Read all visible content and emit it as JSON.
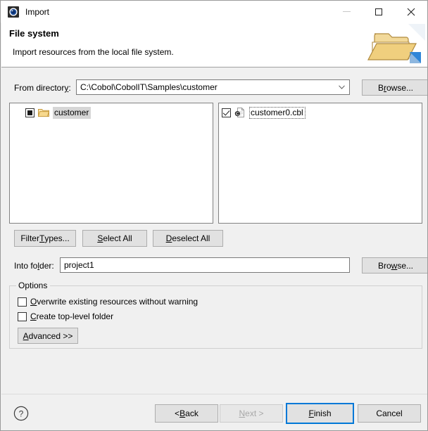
{
  "window": {
    "title": "Import",
    "icon": "eclipse-import-icon",
    "controls": {
      "minimize": "minimize-icon",
      "maximize": "maximize-icon",
      "close": "close-icon"
    }
  },
  "header": {
    "title": "File system",
    "description": "Import resources from the local file system.",
    "graphic": "open-folder-import-icon"
  },
  "from_directory": {
    "label": "From directory:",
    "value": "C:\\Cobol\\CobolIT\\Samples\\customer",
    "browse_label": "Browse..."
  },
  "source_tree": {
    "items": [
      {
        "label": "customer",
        "icon": "folder-icon",
        "checkbox_state": "partial",
        "selected": true
      }
    ]
  },
  "file_list": {
    "items": [
      {
        "label": "customer0.cbl",
        "icon": "cobol-file-icon",
        "checkbox_state": "checked",
        "focused": true
      }
    ]
  },
  "selection_buttons": {
    "filter_types": "Filter Types...",
    "select_all": "Select All",
    "deselect_all": "Deselect All"
  },
  "into_folder": {
    "label": "Into folder:",
    "value": "project1",
    "browse_label": "Browse..."
  },
  "options": {
    "group_title": "Options",
    "items": [
      {
        "label": "Overwrite existing resources without warning",
        "checked": false
      },
      {
        "label": "Create top-level folder",
        "checked": false
      }
    ],
    "advanced_label": "Advanced >>"
  },
  "footer": {
    "help_icon": "help-icon",
    "back": "< Back",
    "next": "Next >",
    "finish": "Finish",
    "cancel": "Cancel"
  },
  "colors": {
    "dialog_background": "#f0f0f0",
    "header_background": "#ffffff",
    "default_button_border": "#0078d7",
    "button_face": "#e1e1e1",
    "disabled_text": "#a8a8a8",
    "folder_icon": "#e9c878"
  }
}
